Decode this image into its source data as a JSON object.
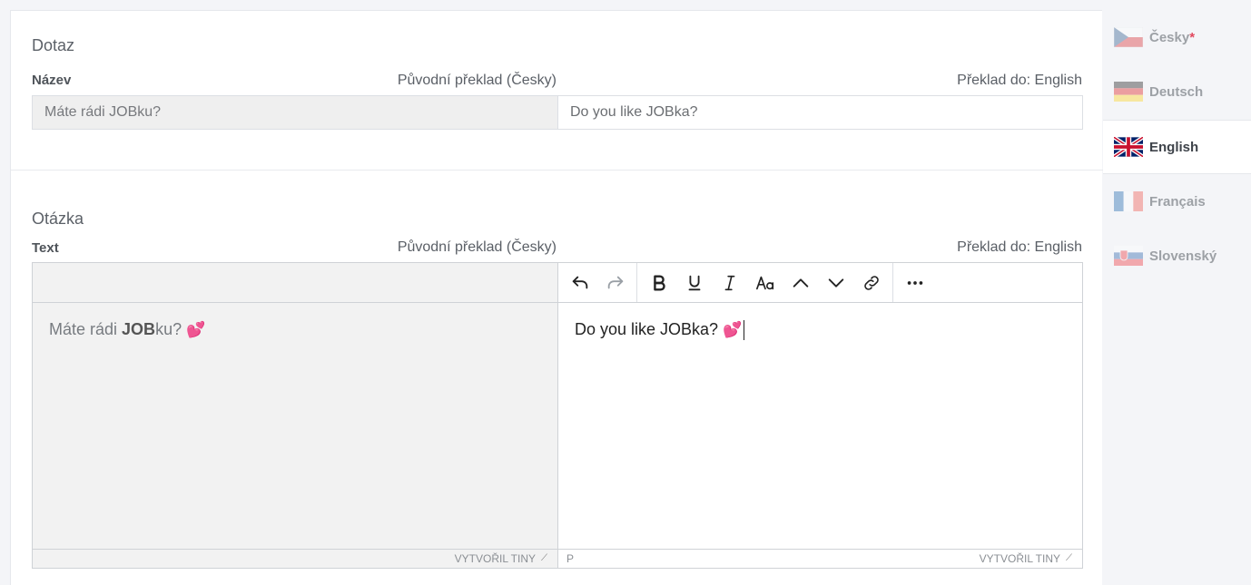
{
  "section1": {
    "title": "Dotaz",
    "label": "Název",
    "original_header": "Původní překlad (Česky)",
    "target_header": "Překlad do: English",
    "original_value": "Máte rádi JOBku?",
    "translation_value": "Do you like JOBka?"
  },
  "section2": {
    "title": "Otázka",
    "label": "Text",
    "original_header": "Původní překlad (Česky)",
    "target_header": "Překlad do: English",
    "original_prefix": "Máte rádi ",
    "original_bold": "JOB",
    "original_suffix": "ku? ",
    "original_emoji": "💕",
    "translation_text": "Do you like JOBka? ",
    "translation_emoji": "💕",
    "left_status": "VYTVOŘIL TINY",
    "right_status_path": "P",
    "right_status": "VYTVOŘIL TINY"
  },
  "toolbar": {
    "icons": [
      "undo-icon",
      "redo-icon",
      "bold-icon",
      "underline-icon",
      "italic-icon",
      "font-size-icon",
      "chevron-up-icon",
      "chevron-down-icon",
      "link-icon",
      "more-icon"
    ]
  },
  "languages": [
    {
      "label": "Česky",
      "required_mark": "*",
      "active": false
    },
    {
      "label": "Deutsch",
      "active": false
    },
    {
      "label": "English",
      "active": true
    },
    {
      "label": "Français",
      "active": false
    },
    {
      "label": "Slovenský",
      "active": false
    }
  ]
}
